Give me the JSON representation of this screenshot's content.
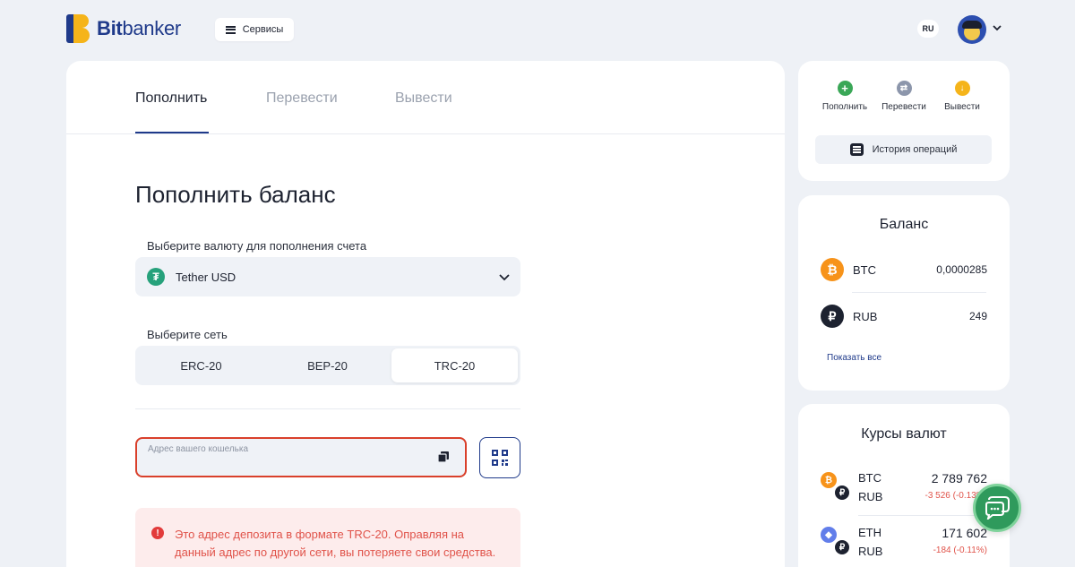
{
  "header": {
    "logo_bold": "Bit",
    "logo_light": "banker",
    "services_label": "Сервисы",
    "lang": "RU"
  },
  "tabs": [
    {
      "label": "Пополнить",
      "active": true
    },
    {
      "label": "Перевести",
      "active": false
    },
    {
      "label": "Вывести",
      "active": false
    }
  ],
  "deposit": {
    "title": "Пополнить баланс",
    "currency_label": "Выберите валюту для пополнения счета",
    "currency_value": "Tether USD",
    "network_label": "Выберите сеть",
    "networks": [
      "ERC-20",
      "BEP-20",
      "TRC-20"
    ],
    "selected_network": "TRC-20",
    "address_placeholder": "Адрес вашего кошелька",
    "warning": "Это адрес депозита в формате TRC-20. Оправляя на данный адрес по другой сети, вы потеряете свои средства."
  },
  "actions": {
    "items": [
      {
        "label": "Пополнить",
        "icon": "plus-icon",
        "color": "#3aa757"
      },
      {
        "label": "Перевести",
        "icon": "transfer-icon",
        "color": "#8c96ab"
      },
      {
        "label": "Вывести",
        "icon": "withdraw-icon",
        "color": "#f5b41a"
      }
    ],
    "history_label": "История операций"
  },
  "balance": {
    "title": "Баланс",
    "rows": [
      {
        "symbol": "BTC",
        "value": "0,0000285",
        "icon": "bitcoin-icon",
        "color": "#f7931a"
      },
      {
        "symbol": "RUB",
        "value": "249",
        "icon": "ruble-icon",
        "color": "#1d2230"
      }
    ],
    "show_all": "Показать все"
  },
  "rates": {
    "title": "Курсы валют",
    "rows": [
      {
        "base": "BTC",
        "quote": "RUB",
        "value": "2 789 762",
        "change": "-3 526 (-0.13%)",
        "icon": "bitcoin-icon",
        "color": "#f7931a"
      },
      {
        "base": "ETH",
        "quote": "RUB",
        "value": "171 602",
        "change": "-184 (-0.11%)",
        "icon": "ethereum-icon",
        "color": "#627eea"
      }
    ]
  },
  "colors": {
    "accent": "#1f3a8a",
    "brand_yellow": "#f5b41a",
    "error": "#d9402b",
    "chat": "#2f9a5c"
  }
}
